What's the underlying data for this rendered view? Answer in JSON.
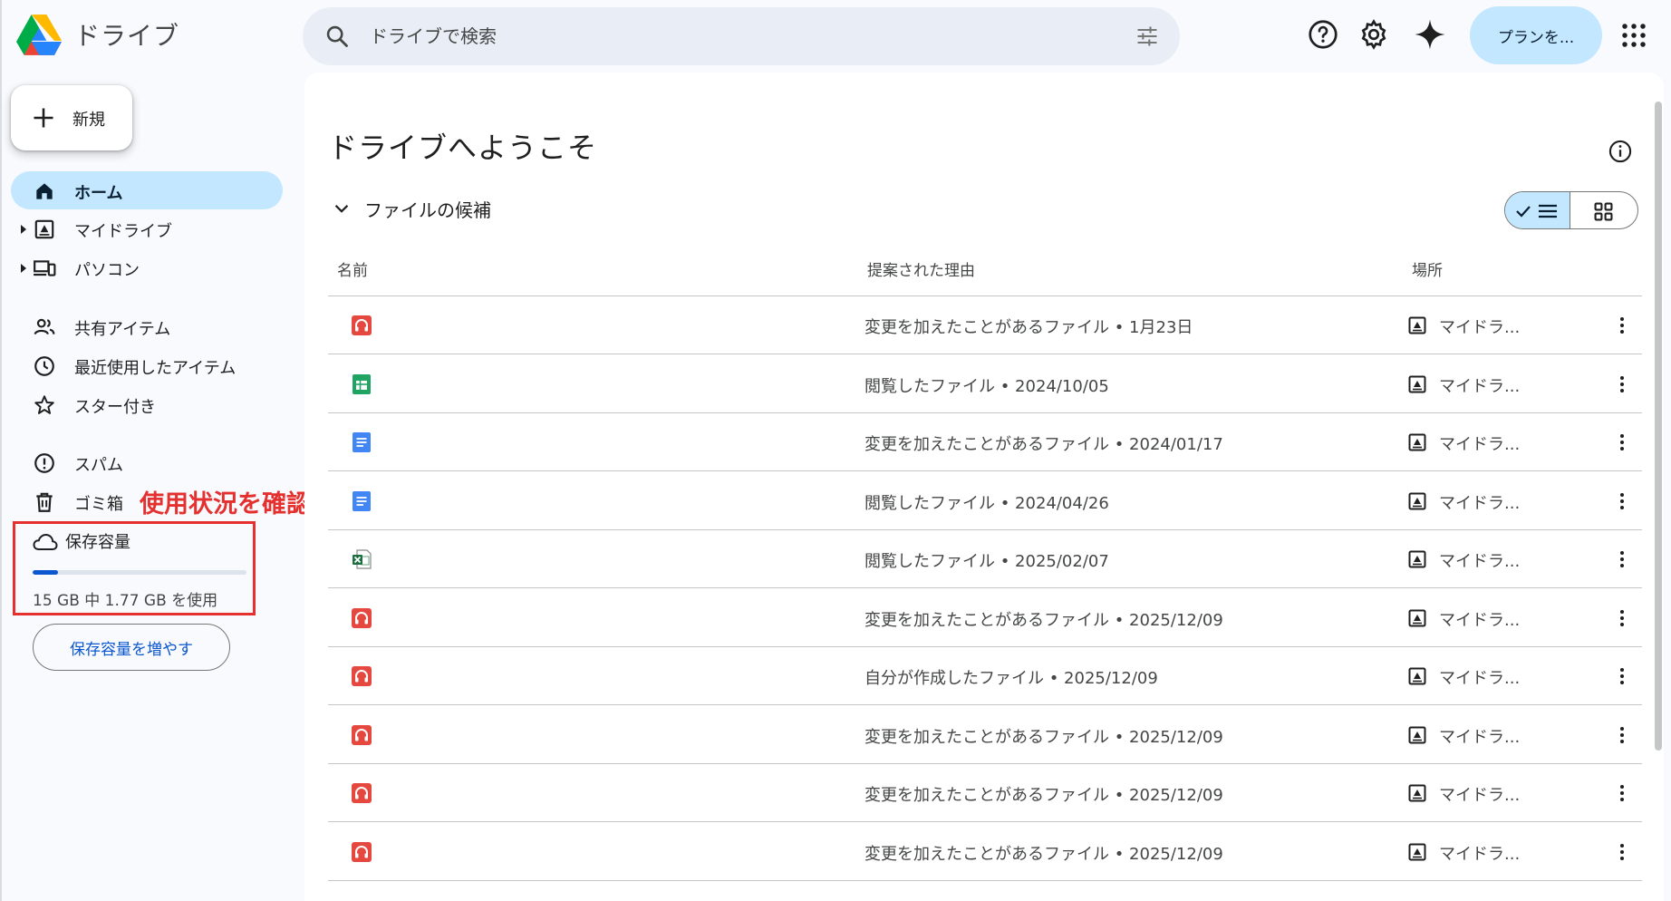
{
  "app": {
    "title": "ドライブ"
  },
  "search": {
    "placeholder": "ドライブで検索"
  },
  "header": {
    "plan_label": "プランを..."
  },
  "sidebar": {
    "new_label": "新規",
    "items": [
      {
        "label": "ホーム",
        "icon": "home-icon",
        "active": true
      },
      {
        "label": "マイドライブ",
        "icon": "my-drive-icon"
      },
      {
        "label": "パソコン",
        "icon": "computers-icon"
      },
      {
        "label": "共有アイテム",
        "icon": "shared-icon"
      },
      {
        "label": "最近使用したアイテム",
        "icon": "clock-icon"
      },
      {
        "label": "スター付き",
        "icon": "star-icon"
      },
      {
        "label": "スパム",
        "icon": "spam-icon"
      },
      {
        "label": "ゴミ箱",
        "icon": "trash-icon"
      }
    ],
    "storage": {
      "label": "保存容量",
      "usage_text": "15 GB 中 1.77 GB を使用",
      "used_fraction": 0.118,
      "button_label": "保存容量を増やす"
    }
  },
  "annotation": {
    "text": "使用状況を確認",
    "color": "#e4302e"
  },
  "main": {
    "title": "ドライブへようこそ",
    "section_title": "ファイルの候補",
    "columns": {
      "name": "名前",
      "reason": "提案された理由",
      "location": "場所"
    },
    "rows": [
      {
        "type": "audio",
        "reason": "変更を加えたことがあるファイル • 1月23日",
        "location": "マイドラ..."
      },
      {
        "type": "sheets",
        "reason": "閲覧したファイル • 2024/10/05",
        "location": "マイドラ..."
      },
      {
        "type": "docs",
        "reason": "変更を加えたことがあるファイル • 2024/01/17",
        "location": "マイドラ..."
      },
      {
        "type": "docs",
        "reason": "閲覧したファイル • 2024/04/26",
        "location": "マイドラ..."
      },
      {
        "type": "excel",
        "reason": "閲覧したファイル • 2025/02/07",
        "location": "マイドラ..."
      },
      {
        "type": "audio",
        "reason": "変更を加えたことがあるファイル • 2025/12/09",
        "location": "マイドラ..."
      },
      {
        "type": "audio",
        "reason": "自分が作成したファイル • 2025/12/09",
        "location": "マイドラ..."
      },
      {
        "type": "audio",
        "reason": "変更を加えたことがあるファイル • 2025/12/09",
        "location": "マイドラ..."
      },
      {
        "type": "audio",
        "reason": "変更を加えたことがあるファイル • 2025/12/09",
        "location": "マイドラ..."
      },
      {
        "type": "audio",
        "reason": "変更を加えたことがあるファイル • 2025/12/09",
        "location": "マイドラ..."
      }
    ]
  },
  "colors": {
    "accent": "#0b57d0",
    "selected_bg": "#c2e7ff",
    "search_bg": "#e9eef6",
    "audio_icon": "#e5483f",
    "sheets_icon": "#1fa463",
    "docs_icon": "#4285f4",
    "excel_icon": "#1d6f42"
  }
}
